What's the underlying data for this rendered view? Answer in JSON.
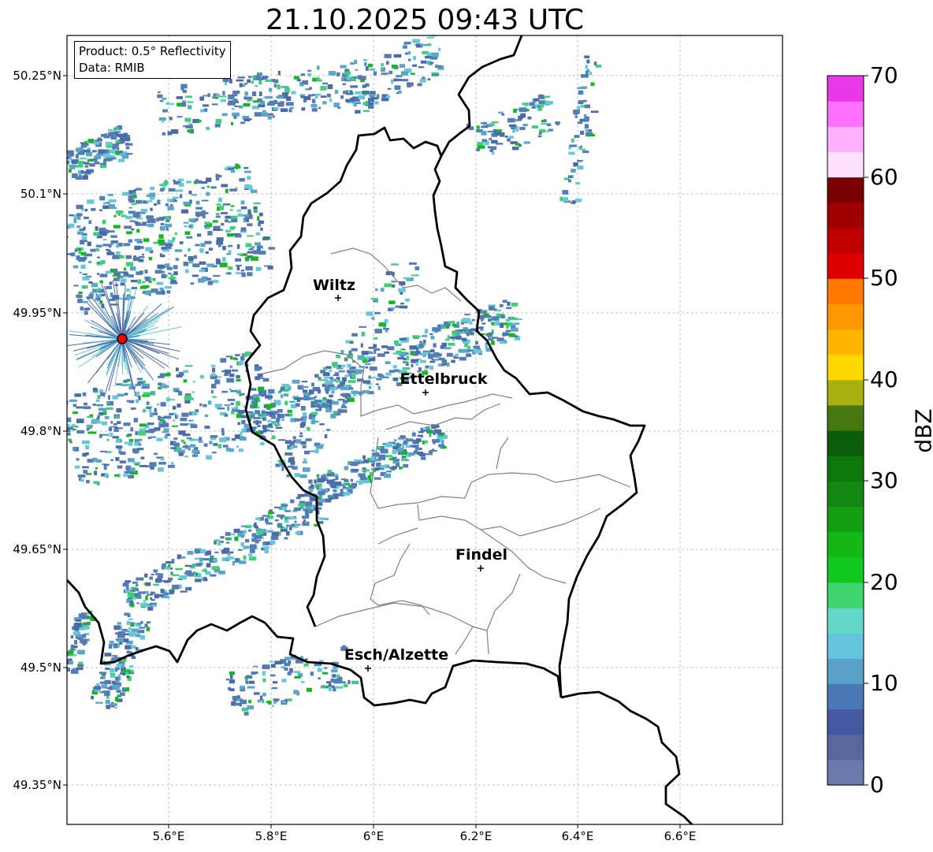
{
  "title": "21.10.2025 09:43 UTC",
  "info": {
    "product": "Product: 0.5° Reflectivity",
    "data": "Data: RMIB"
  },
  "axes": {
    "lat_labels": [
      "50.25°N",
      "50.1°N",
      "49.95°N",
      "49.8°N",
      "49.65°N",
      "49.5°N",
      "49.35°N"
    ],
    "lon_labels": [
      "5.6°E",
      "5.8°E",
      "6°E",
      "6.2°E",
      "6.4°E",
      "6.6°E"
    ]
  },
  "cities": [
    {
      "name": "Wiltz"
    },
    {
      "name": "Ettelbruck"
    },
    {
      "name": "Findel"
    },
    {
      "name": "Esch/Alzette"
    }
  ],
  "colorbar": {
    "label": "dBZ",
    "ticks": [
      "70",
      "60",
      "50",
      "40",
      "30",
      "20",
      "10",
      "0"
    ],
    "colors": [
      "#6a7aaa",
      "#58689e",
      "#4558a2",
      "#4a78b4",
      "#5aa0c8",
      "#64c4dc",
      "#64d8c8",
      "#40d470",
      "#10c820",
      "#14b814",
      "#12a012",
      "#128812",
      "#0c780c",
      "#0a5e0a",
      "#467810",
      "#a8b010",
      "#ffd800",
      "#ffb400",
      "#ff9800",
      "#ff7800",
      "#e00000",
      "#c00000",
      "#a00000",
      "#780000",
      "#ffe0ff",
      "#ffb0ff",
      "#ff70ff",
      "#e838e8"
    ]
  },
  "colors": {
    "border": "#000000",
    "canton": "#808080",
    "grid": "#b0b0b0",
    "radar_site": "#ff0000"
  }
}
